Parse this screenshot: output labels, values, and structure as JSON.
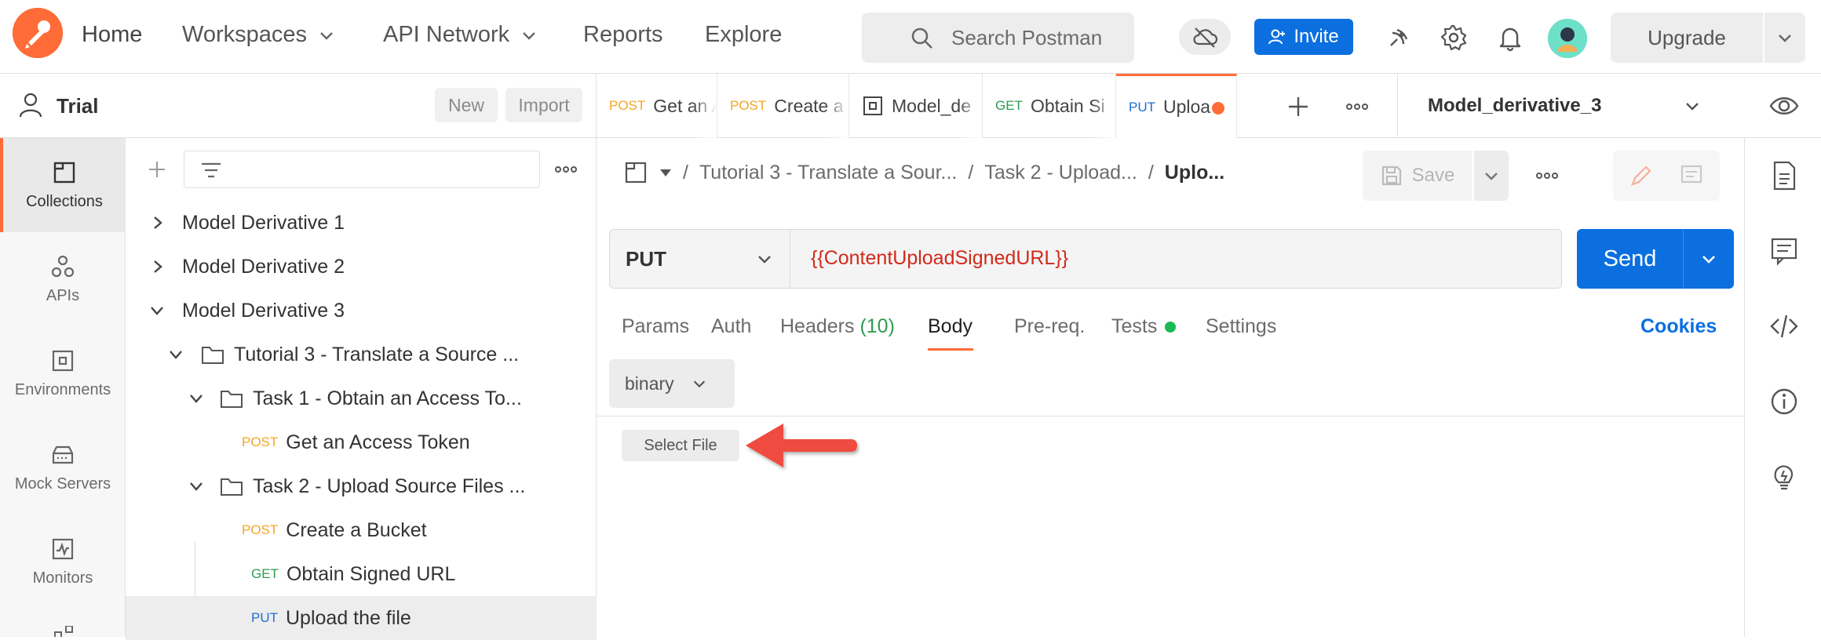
{
  "topbar": {
    "nav": [
      {
        "label": "Home"
      },
      {
        "label": "Workspaces"
      },
      {
        "label": "API Network"
      },
      {
        "label": "Reports"
      },
      {
        "label": "Explore"
      }
    ],
    "search_placeholder": "Search Postman",
    "invite_label": "Invite",
    "upgrade_label": "Upgrade"
  },
  "workspace": {
    "name": "Trial",
    "new_label": "New",
    "import_label": "Import"
  },
  "rail": [
    {
      "label": "Collections",
      "icon": "collections-icon",
      "active": true
    },
    {
      "label": "APIs",
      "icon": "apis-icon"
    },
    {
      "label": "Environments",
      "icon": "environments-icon"
    },
    {
      "label": "Mock Servers",
      "icon": "mock-servers-icon"
    },
    {
      "label": "Monitors",
      "icon": "monitors-icon"
    }
  ],
  "tree": [
    {
      "label": "Model Derivative 1",
      "type": "collection"
    },
    {
      "label": "Model Derivative 2",
      "type": "collection"
    },
    {
      "label": "Model Derivative 3",
      "type": "collection"
    },
    {
      "label": "Tutorial 3 - Translate a Source ...",
      "type": "folder"
    },
    {
      "label": "Task 1 - Obtain an Access To...",
      "type": "folder"
    },
    {
      "label": "Get an Access Token",
      "method": "POST"
    },
    {
      "label": "Task 2 - Upload Source Files ...",
      "type": "folder"
    },
    {
      "label": "Create a Bucket",
      "method": "POST"
    },
    {
      "label": "Obtain Signed URL",
      "method": "GET"
    },
    {
      "label": "Upload the file",
      "method": "PUT",
      "selected": true
    }
  ],
  "tabs": [
    {
      "method": "POST",
      "label": "Get an A"
    },
    {
      "method": "POST",
      "label": "Create a"
    },
    {
      "method": "",
      "label": "Model_de"
    },
    {
      "method": "GET",
      "label": "Obtain Si"
    },
    {
      "method": "PUT",
      "label": "Uploa",
      "active": true
    }
  ],
  "environment": "Model_derivative_3",
  "breadcrumb": [
    "Tutorial 3 - Translate a Sour...",
    "Task 2 - Upload...",
    "Uplo..."
  ],
  "save_label": "Save",
  "request": {
    "method": "PUT",
    "url": "{{ContentUploadSignedURL}}",
    "send_label": "Send"
  },
  "request_tabs": {
    "params": "Params",
    "auth": "Auth",
    "headers": "Headers",
    "headers_count": "(10)",
    "body": "Body",
    "prereq": "Pre-req.",
    "tests": "Tests",
    "settings": "Settings",
    "cookies": "Cookies"
  },
  "body": {
    "type": "binary",
    "select_file_label": "Select File"
  },
  "colors": {
    "accent": "#ff6c37",
    "primary": "#0b6fe0",
    "post": "#f5a524",
    "get": "#2e9c4f",
    "put": "#1d6fd1",
    "url": "#d12a1a",
    "arrow": "#ef4b3f"
  }
}
